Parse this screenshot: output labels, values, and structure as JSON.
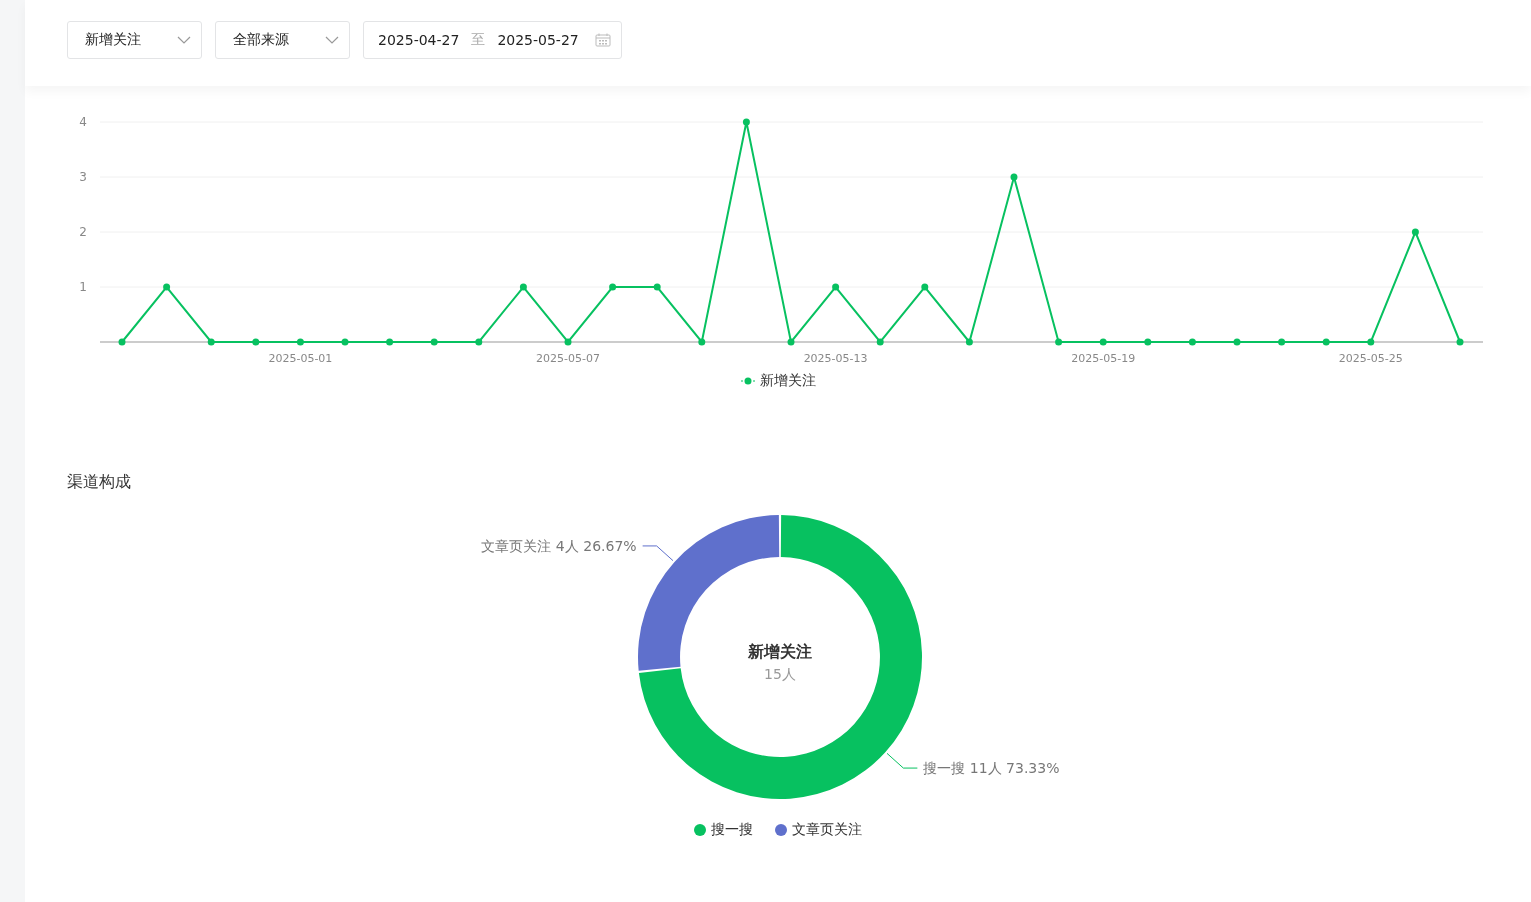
{
  "filters": {
    "metric_select": {
      "value": "新增关注"
    },
    "source_select": {
      "value": "全部来源"
    },
    "date_range": {
      "start": "2025-04-27",
      "separator": "至",
      "end": "2025-05-27"
    }
  },
  "trend": {
    "chart_data": {
      "type": "line",
      "categories": [
        null,
        null,
        null,
        null,
        "2025-05-01",
        null,
        null,
        null,
        null,
        null,
        "2025-05-07",
        null,
        null,
        null,
        null,
        null,
        "2025-05-13",
        null,
        null,
        null,
        null,
        null,
        "2025-05-19",
        null,
        null,
        null,
        null,
        null,
        "2025-05-25",
        null,
        null
      ],
      "grid": true,
      "series": [
        {
          "name": "新增关注",
          "color": "#07c160",
          "marker": true,
          "values": [
            0,
            1,
            0,
            0,
            0,
            0,
            0,
            0,
            0,
            1,
            0,
            1,
            1,
            0,
            4,
            0,
            1,
            0,
            1,
            0,
            3,
            0,
            0,
            0,
            0,
            0,
            0,
            0,
            0,
            2,
            0
          ]
        }
      ],
      "ylim": [
        0,
        4
      ],
      "yticks": [
        1,
        2,
        3,
        4
      ]
    }
  },
  "channels": {
    "title": "渠道构成",
    "center_title": "新增关注",
    "center_value": "15人",
    "chart_data": {
      "type": "donut",
      "categories": [
        "搜一搜",
        "文章页关注"
      ],
      "values": [
        11,
        4
      ],
      "colors": [
        "#07c160",
        "#5f70cc"
      ],
      "value_labels": [
        "搜一搜 11人 73.33%",
        "文章页关注 4人 26.67%"
      ]
    }
  }
}
